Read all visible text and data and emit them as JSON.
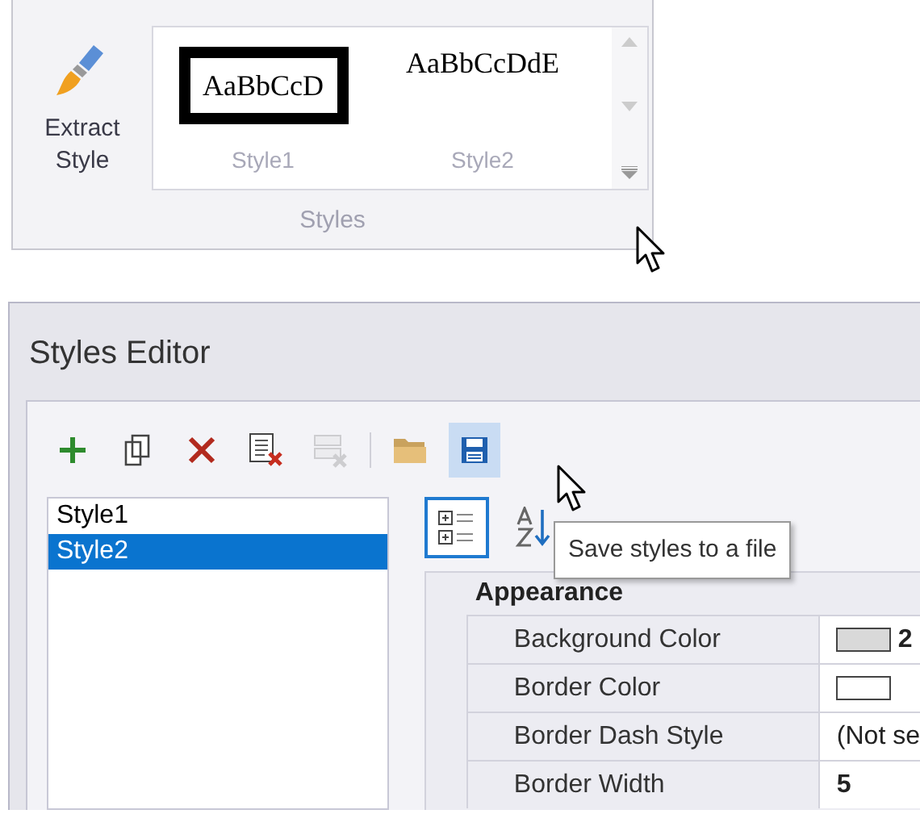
{
  "ribbon": {
    "extract_button": {
      "label": "Extract Style"
    },
    "gallery": [
      {
        "preview": "AaBbCcD",
        "name": "Style1",
        "framed": true
      },
      {
        "preview": "AaBbCcDdE",
        "name": "Style2",
        "framed": false
      }
    ],
    "group_label": "Styles"
  },
  "editor": {
    "title": "Styles Editor",
    "toolbar": [
      {
        "kind": "add",
        "disabled": false,
        "selected": false
      },
      {
        "kind": "copy",
        "disabled": false,
        "selected": false
      },
      {
        "kind": "delete",
        "disabled": false,
        "selected": false
      },
      {
        "kind": "delete-list",
        "disabled": false,
        "selected": false
      },
      {
        "kind": "clear",
        "disabled": true,
        "selected": false
      },
      {
        "kind": "separator"
      },
      {
        "kind": "open",
        "disabled": false,
        "selected": false
      },
      {
        "kind": "save",
        "disabled": false,
        "selected": true
      }
    ],
    "styles_list": [
      {
        "label": "Style1",
        "selected": false
      },
      {
        "label": "Style2",
        "selected": true
      }
    ],
    "grid_buttons": [
      {
        "kind": "categorized",
        "selected": true
      },
      {
        "kind": "alphabetical",
        "selected": false
      }
    ],
    "tooltip": "Save styles to a file",
    "category": "Appearance",
    "properties": [
      {
        "name": "Background Color",
        "kind": "color",
        "color": "#d9d9d9",
        "value": "2"
      },
      {
        "name": "Border Color",
        "kind": "color",
        "color": "#ffffff"
      },
      {
        "name": "Border Dash Style",
        "kind": "text",
        "value": "(Not se"
      },
      {
        "name": "Border Width",
        "kind": "number",
        "value": "5"
      }
    ]
  }
}
